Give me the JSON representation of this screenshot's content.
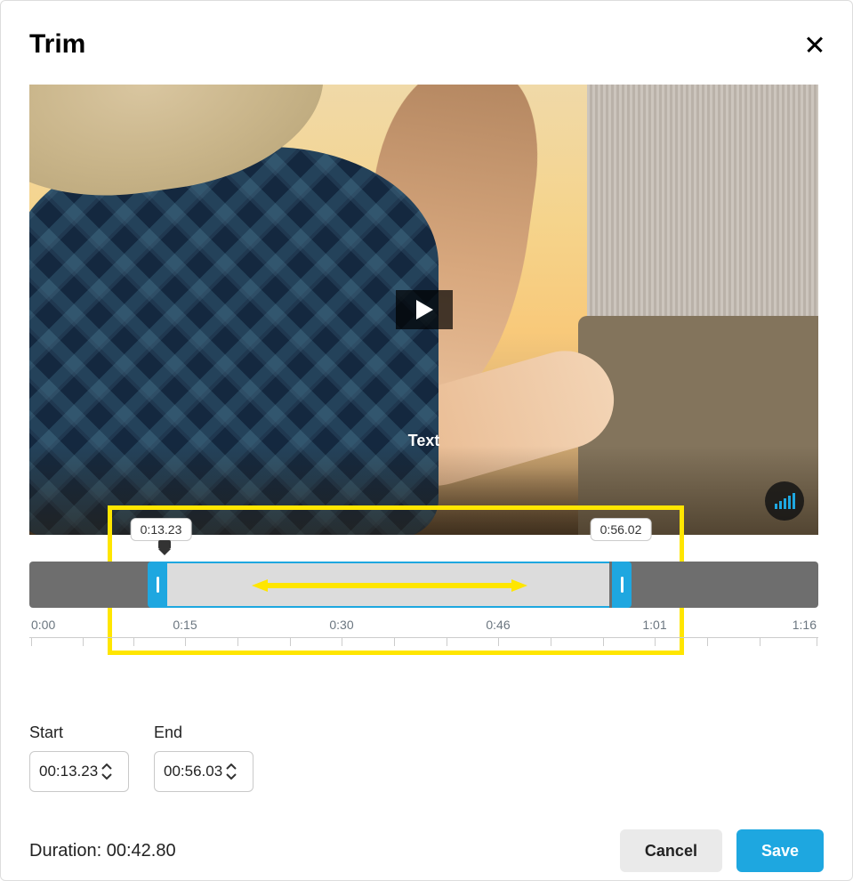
{
  "dialog": {
    "title": "Trim"
  },
  "video": {
    "overlay_text": "Text"
  },
  "timeline": {
    "start_tooltip": "0:13.23",
    "end_tooltip": "0:56.02",
    "ticks": [
      "0:00",
      "0:15",
      "0:30",
      "0:46",
      "1:01",
      "1:16"
    ]
  },
  "fields": {
    "start_label": "Start",
    "start_value": "00:13.23",
    "end_label": "End",
    "end_value": "00:56.03"
  },
  "footer": {
    "duration_label": "Duration:",
    "duration_value": "00:42.80",
    "cancel": "Cancel",
    "save": "Save"
  },
  "colors": {
    "accent": "#1ea7e0",
    "highlight": "#ffe600"
  }
}
